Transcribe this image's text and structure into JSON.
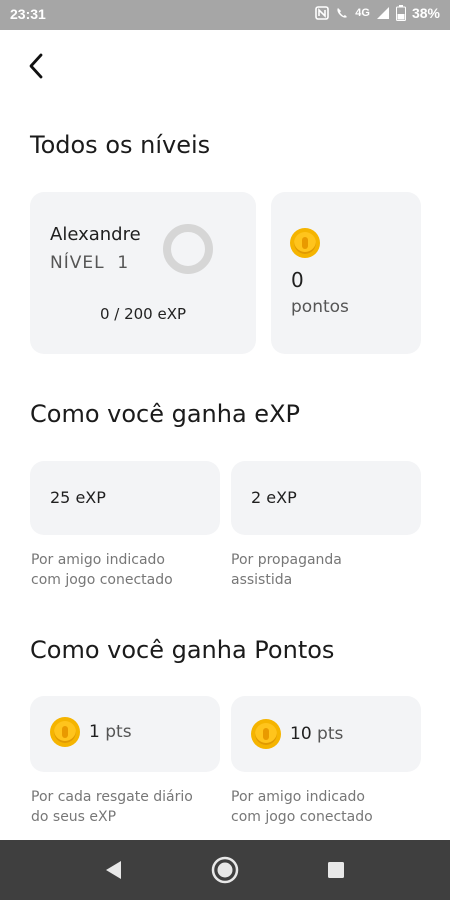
{
  "status_bar": {
    "time": "23:31",
    "network": "4G",
    "battery": "38%"
  },
  "header": {
    "back_icon": "arrow-left-icon"
  },
  "levels": {
    "title": "Todos os níveis",
    "user_name": "Alexandre",
    "level_label": "NÍVEL",
    "level_value": "1",
    "xp_progress": "0 / 200 eXP",
    "xp_progress_fraction": 0,
    "points_value": "0",
    "points_label": "pontos"
  },
  "earn_exp": {
    "title": "Como você ganha eXP",
    "items": [
      {
        "value": "25 eXP",
        "description_line1": "Por amigo indicado",
        "description_line2": "com jogo conectado"
      },
      {
        "value": "2 eXP",
        "description_line1": "Por propaganda",
        "description_line2": "assistida"
      }
    ]
  },
  "earn_points": {
    "title": "Como você ganha Pontos",
    "items": [
      {
        "amount": "1",
        "unit": "pts",
        "description_line1": "Por cada resgate diário",
        "description_line2": "do seus eXP"
      },
      {
        "amount": "10",
        "unit": "pts",
        "description_line1": "Por amigo indicado",
        "description_line2": "com jogo conectado"
      }
    ]
  },
  "colors": {
    "coin": "#ffc41c",
    "card_bg": "#f3f4f6",
    "status_bar": "#a6a6a6",
    "nav_bar": "#3f3f3f",
    "ring": "#d6d6d6"
  },
  "nav": {
    "back_icon": "triangle-back-icon",
    "home_icon": "circle-home-icon",
    "recents_icon": "square-recents-icon"
  }
}
